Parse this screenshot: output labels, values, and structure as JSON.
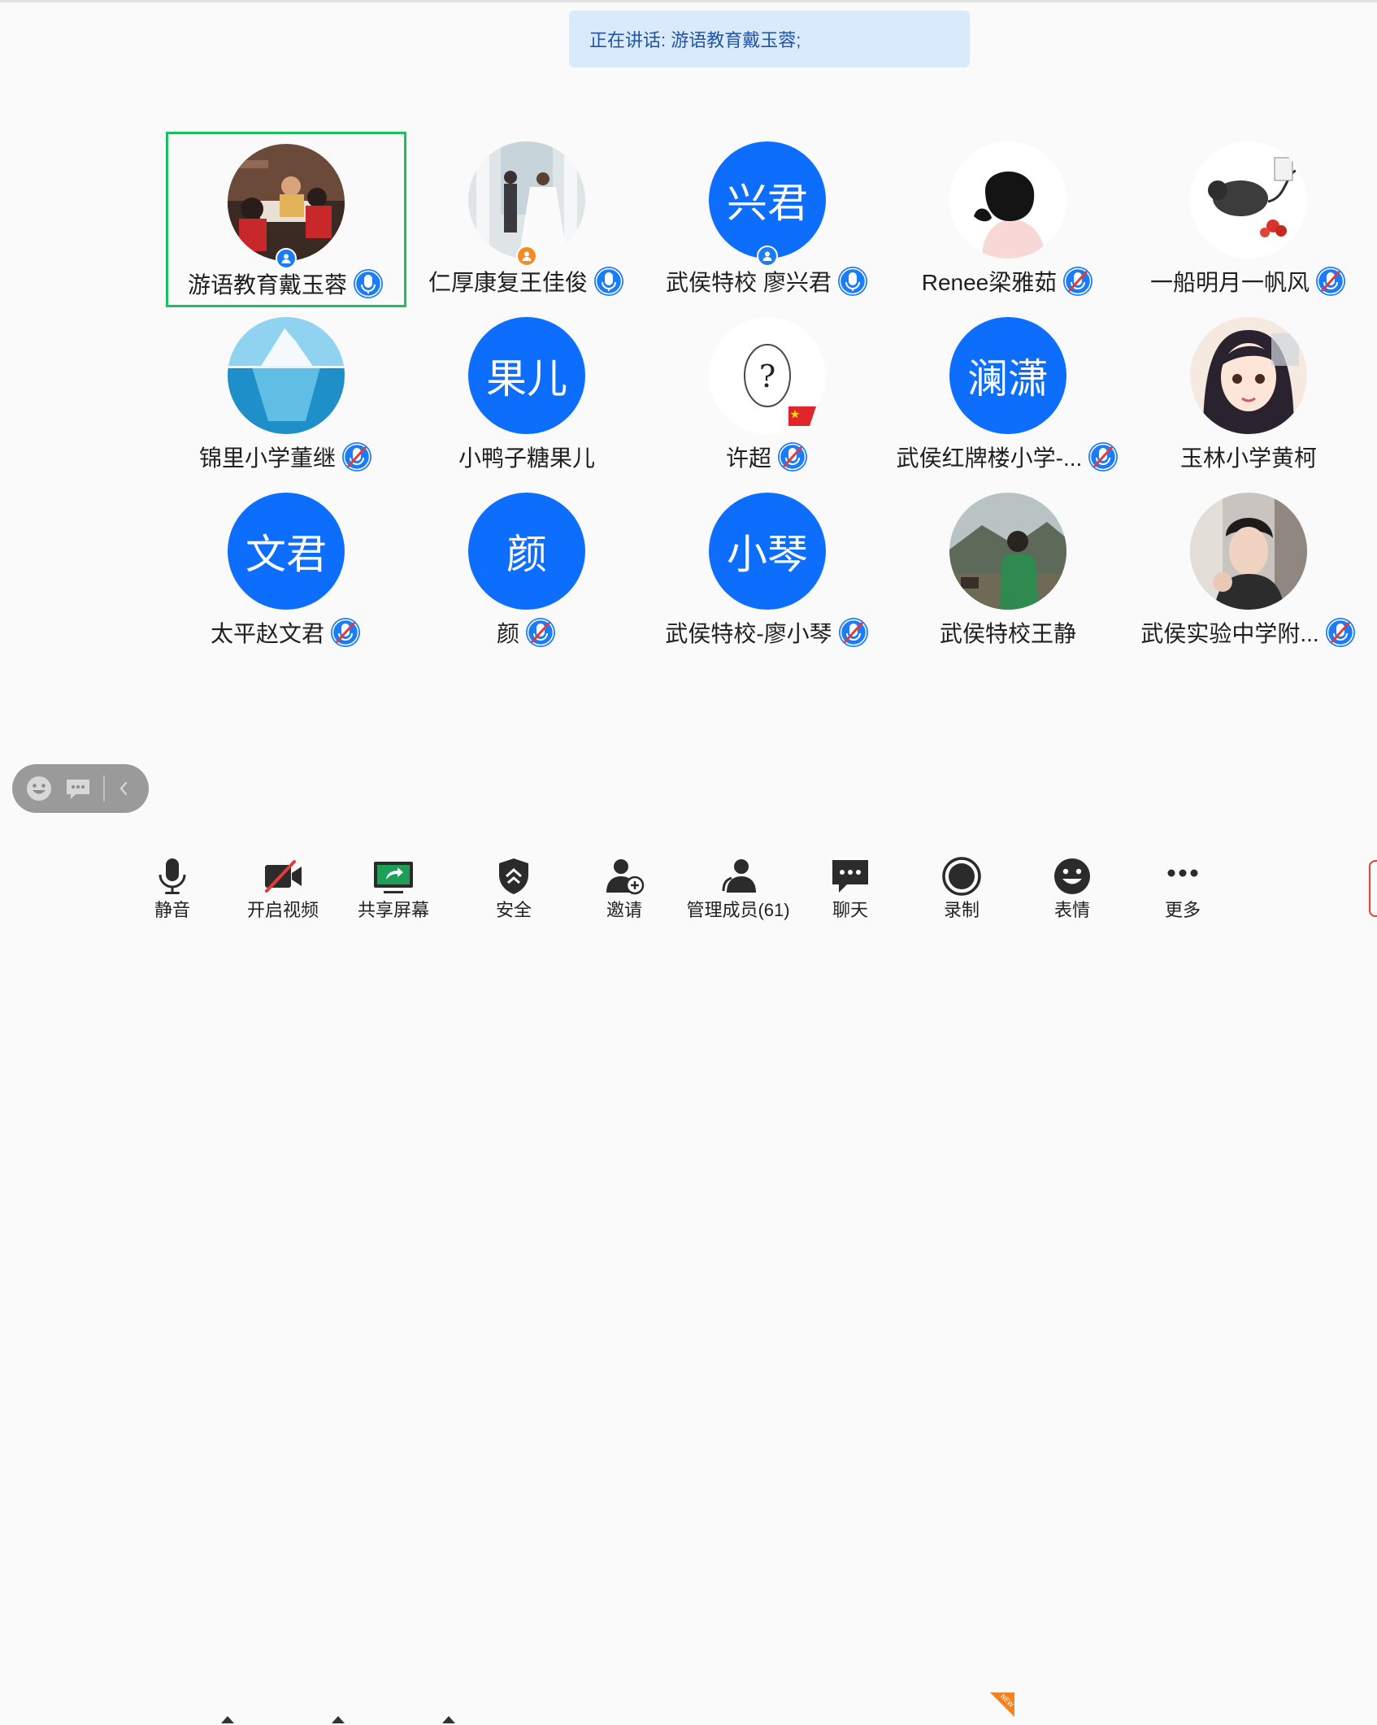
{
  "speaking_banner": {
    "text": "正在讲话: 游语教育戴玉蓉;"
  },
  "participants": [
    {
      "name": "游语教育戴玉蓉",
      "avatar": "photo-group",
      "mic": "on",
      "role": "host",
      "active": true
    },
    {
      "name": "仁厚康复王佳俊",
      "avatar": "photo-wedding",
      "mic": "on",
      "role": "cohost"
    },
    {
      "name": "武侯特校 廖兴君",
      "avatar_text": "兴君",
      "mic": "on",
      "role": "host"
    },
    {
      "name": "Renee梁雅茹",
      "avatar": "photo-illustration-girl",
      "mic": "muted"
    },
    {
      "name": "一船明月一帆风",
      "avatar": "photo-ink-mouse",
      "mic": "muted"
    },
    {
      "name": "锦里小学董继",
      "avatar": "photo-iceberg",
      "mic": "muted"
    },
    {
      "name": "小鸭子糖果儿",
      "avatar_text": "果儿",
      "mic": "none"
    },
    {
      "name": "许超",
      "avatar": "photo-question-egg",
      "mic": "muted",
      "flag": "cn"
    },
    {
      "name": "武侯红牌楼小学-...",
      "avatar_text": "澜潇",
      "mic": "muted"
    },
    {
      "name": "玉林小学黄柯",
      "avatar": "photo-cartoon-woman",
      "mic": "none"
    },
    {
      "name": "太平赵文君",
      "avatar_text": "文君",
      "mic": "muted"
    },
    {
      "name": "颜",
      "avatar_text": "颜",
      "mic": "muted"
    },
    {
      "name": "武侯特校-廖小琴",
      "avatar_text": "小琴",
      "mic": "muted"
    },
    {
      "name": "武侯特校王静",
      "avatar": "photo-green-hoodie",
      "mic": "none"
    },
    {
      "name": "武侯实验中学附...",
      "avatar": "photo-young-man",
      "mic": "muted"
    }
  ],
  "floating_controls": {
    "icons": [
      "emoji-icon",
      "chat-bubble-icon",
      "chevron-left-icon"
    ]
  },
  "toolbar": {
    "mute": "静音",
    "video": "开启视频",
    "share": "共享屏幕",
    "security": "安全",
    "invite": "邀请",
    "members": "管理成员(61)",
    "chat": "聊天",
    "record": "录制",
    "reactions": "表情",
    "more": "更多",
    "new_badge": "NEW"
  },
  "colors": {
    "accent": "#0d6efd",
    "active_border": "#19c160",
    "banner_bg": "#d9eafd",
    "banner_text": "#2254a6"
  }
}
